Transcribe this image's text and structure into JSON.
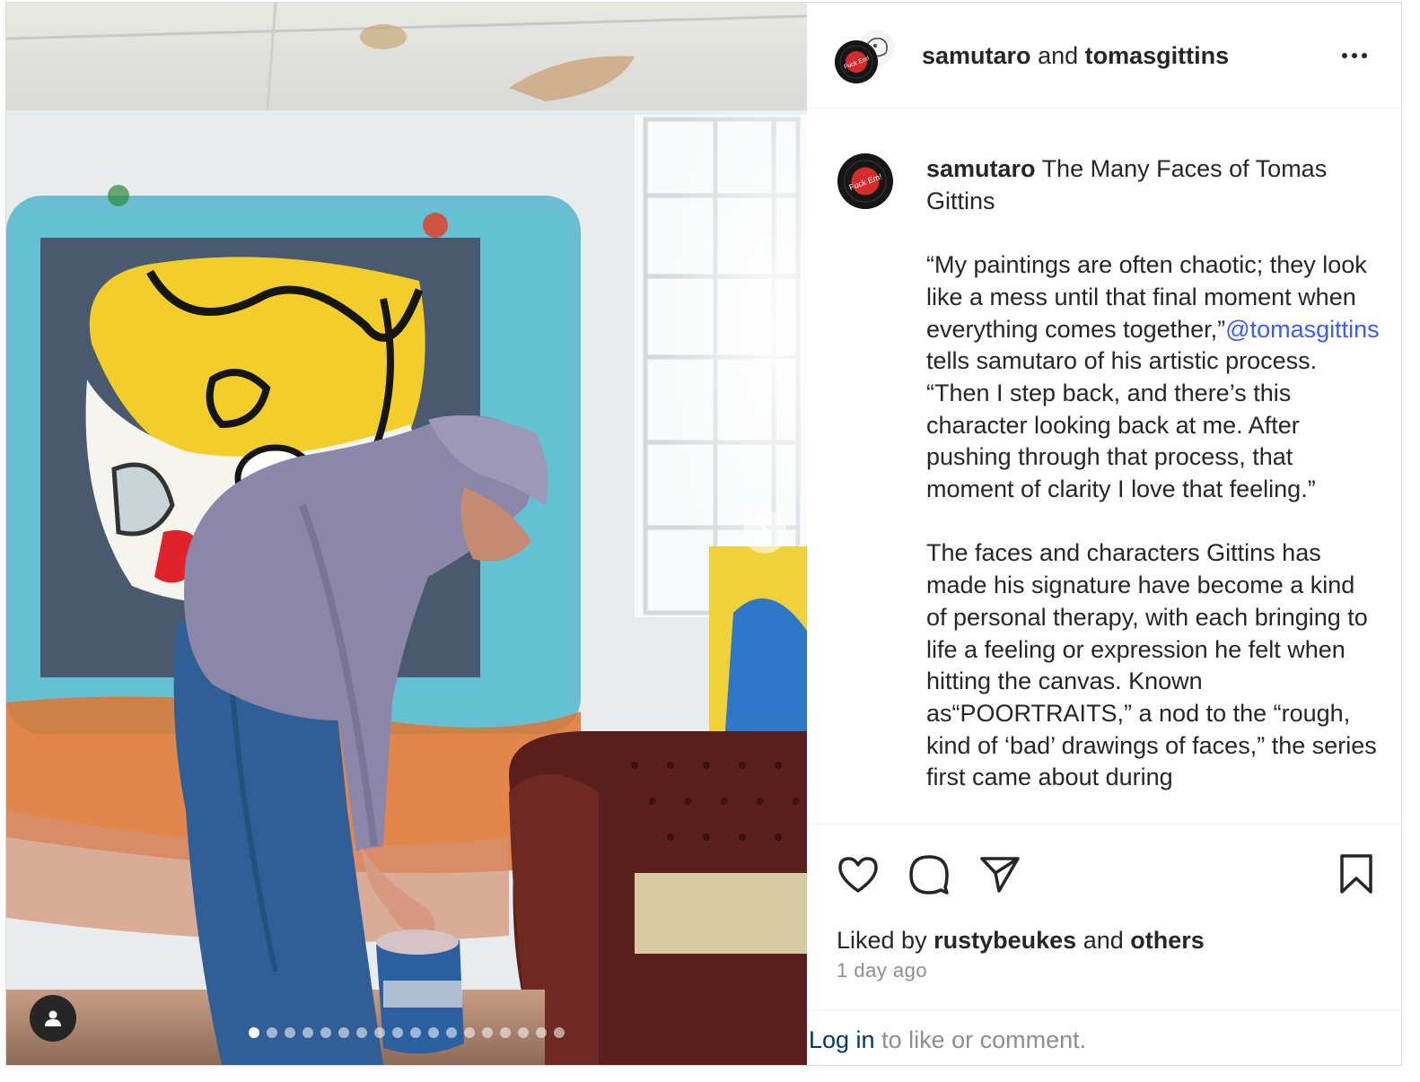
{
  "header": {
    "author1": "samutaro",
    "joiner": "and",
    "author2": "tomasgittins"
  },
  "caption": {
    "username": "samutaro",
    "title": "The Many Faces of Tomas Gittins",
    "p1_before": "“My paintings are often chaotic; they look like a mess until that final moment when everything comes together,”",
    "mention": "@tomasgittins",
    "p1_after": " tells samutaro of his artistic process. “Then I step back, and there’s this character looking back at me. After pushing through that process, that moment of clarity I love that feeling.”",
    "p2": "The faces and characters Gittins has made his signature have become a kind of personal therapy, with each bringing to life a feeling or expression he felt when hitting the canvas. Known as“POORTRAITS,” a nod to the “rough, kind of ‘bad’ drawings of faces,” the series first came about during"
  },
  "likes": {
    "prefix": "Liked by",
    "user": "rustybeukes",
    "joiner": "and",
    "others": "others"
  },
  "time": "1 day ago",
  "footer": {
    "login": "Log in",
    "rest": " to like or comment."
  },
  "carousel": {
    "total_slides": 18,
    "active_index": 0
  },
  "avatar_sticker_text": "Fuck Em!",
  "colors": {
    "link": "#00376b",
    "mention": "#3b5bff",
    "muted": "#8e8e8e",
    "text": "#262626"
  }
}
